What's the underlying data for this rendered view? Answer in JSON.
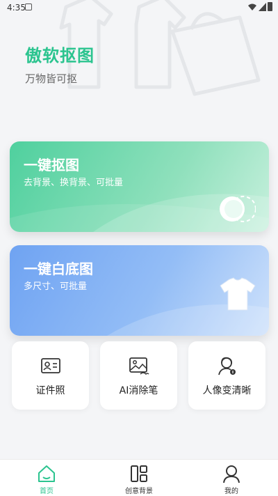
{
  "status_bar": {
    "time": "4:35"
  },
  "brand": {
    "title": "傲软抠图",
    "subtitle": "万物皆可抠"
  },
  "cards": [
    {
      "title": "一键抠图",
      "desc": "去背景、换背景、可批量",
      "color": "#4fd09e"
    },
    {
      "title": "一键白底图",
      "desc": "多尺寸、可批量",
      "color": "#6fa3f2"
    }
  ],
  "tools": [
    {
      "label": "证件照",
      "icon": "id-card-icon"
    },
    {
      "label": "AI消除笔",
      "icon": "image-eraser-icon"
    },
    {
      "label": "人像变清晰",
      "icon": "portrait-enhance-icon"
    }
  ],
  "tabs": [
    {
      "label": "首页",
      "icon": "home-icon",
      "active": true
    },
    {
      "label": "创意背景",
      "icon": "layout-icon",
      "active": false
    },
    {
      "label": "我的",
      "icon": "user-icon",
      "active": false
    }
  ],
  "colors": {
    "accent": "#2bc48f",
    "background": "#f4f5f7"
  }
}
